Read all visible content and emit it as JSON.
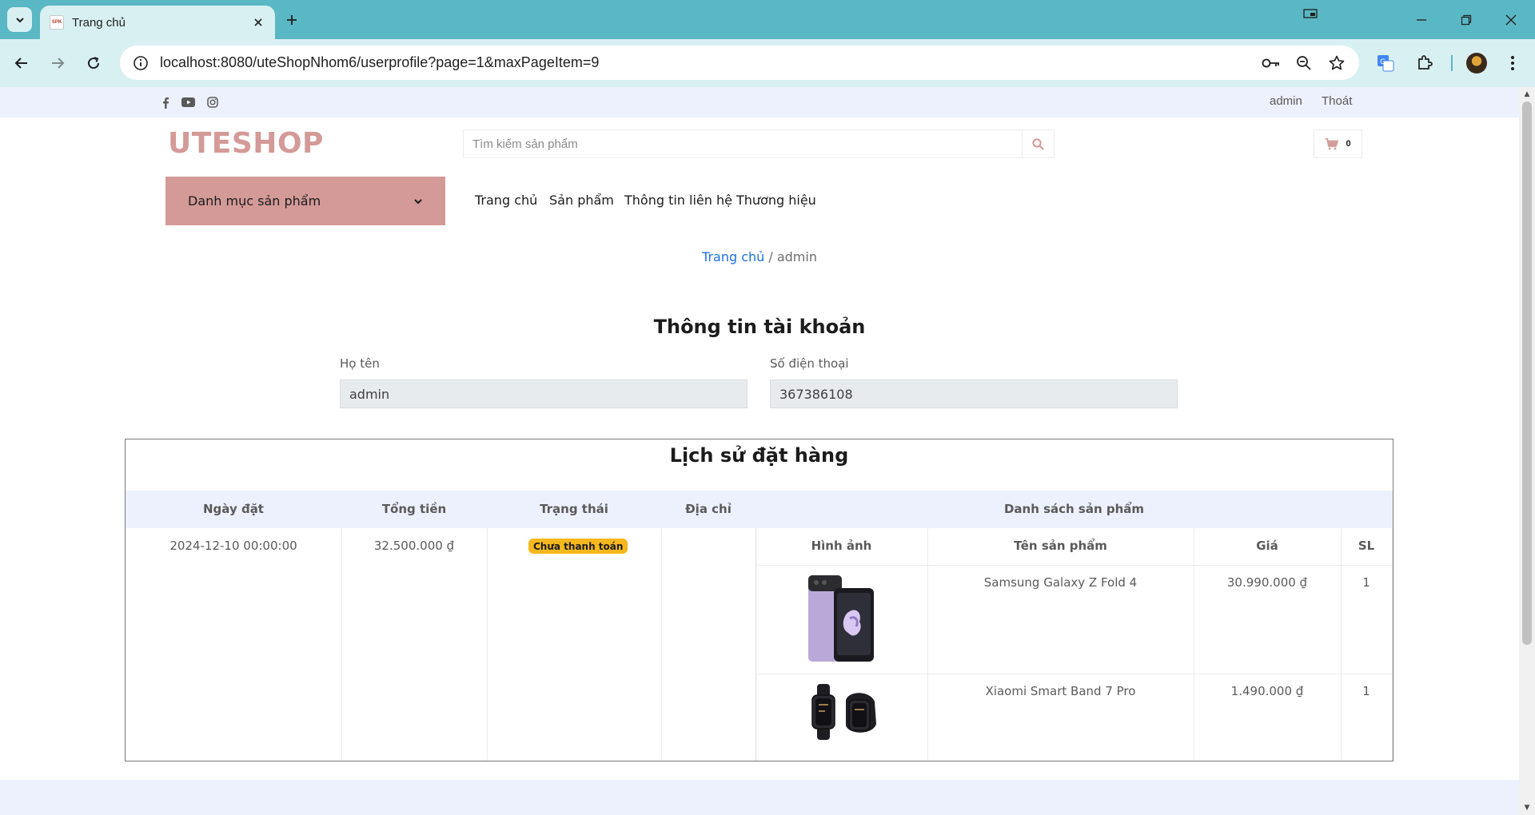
{
  "browser": {
    "tab_title": "Trang chủ",
    "favicon_text": "SPK",
    "url": "localhost:8080/uteShopNhom6/userprofile?page=1&maxPageItem=9"
  },
  "topbar": {
    "social_icons": [
      "facebook-icon",
      "youtube-icon",
      "instagram-icon"
    ],
    "user_link": "admin",
    "logout_link": "Thoát"
  },
  "header": {
    "logo": "UTESHOP",
    "search_placeholder": "Tìm kiếm sản phẩm",
    "cart_count": "0"
  },
  "nav": {
    "category_button": "Danh mục sản phẩm",
    "items": [
      "Trang chủ",
      "Sản phẩm",
      "Thông tin liên hệ",
      "Thương hiệu"
    ]
  },
  "breadcrumb": {
    "home": "Trang chủ",
    "separator": " / ",
    "current": "admin"
  },
  "account": {
    "title": "Thông tin tài khoản",
    "name_label": "Họ tên",
    "name_value": "admin",
    "phone_label": "Số điện thoại",
    "phone_value": "367386108"
  },
  "orders": {
    "title": "Lịch sử đặt hàng",
    "columns": [
      "Ngày đặt",
      "Tổng tiền",
      "Trạng thái",
      "Địa chỉ",
      "Danh sách sản phẩm"
    ],
    "product_columns": [
      "Hình ảnh",
      "Tên sản phẩm",
      "Giá",
      "SL"
    ],
    "rows": [
      {
        "date": "2024-12-10 00:00:00",
        "total": "32.500.000 ₫",
        "status": "Chưa thanh toán",
        "address": "",
        "products": [
          {
            "name": "Samsung Galaxy Z Fold 4",
            "price": "30.990.000 ₫",
            "qty": "1"
          },
          {
            "name": "Xiaomi Smart Band 7 Pro",
            "price": "1.490.000 ₫",
            "qty": "1"
          }
        ]
      }
    ]
  },
  "colors": {
    "brand": "#d49a98",
    "chrome": "#5ab7c4",
    "topbar": "#edf0fd",
    "badge": "#f5b81c",
    "link": "#1a73e8"
  }
}
